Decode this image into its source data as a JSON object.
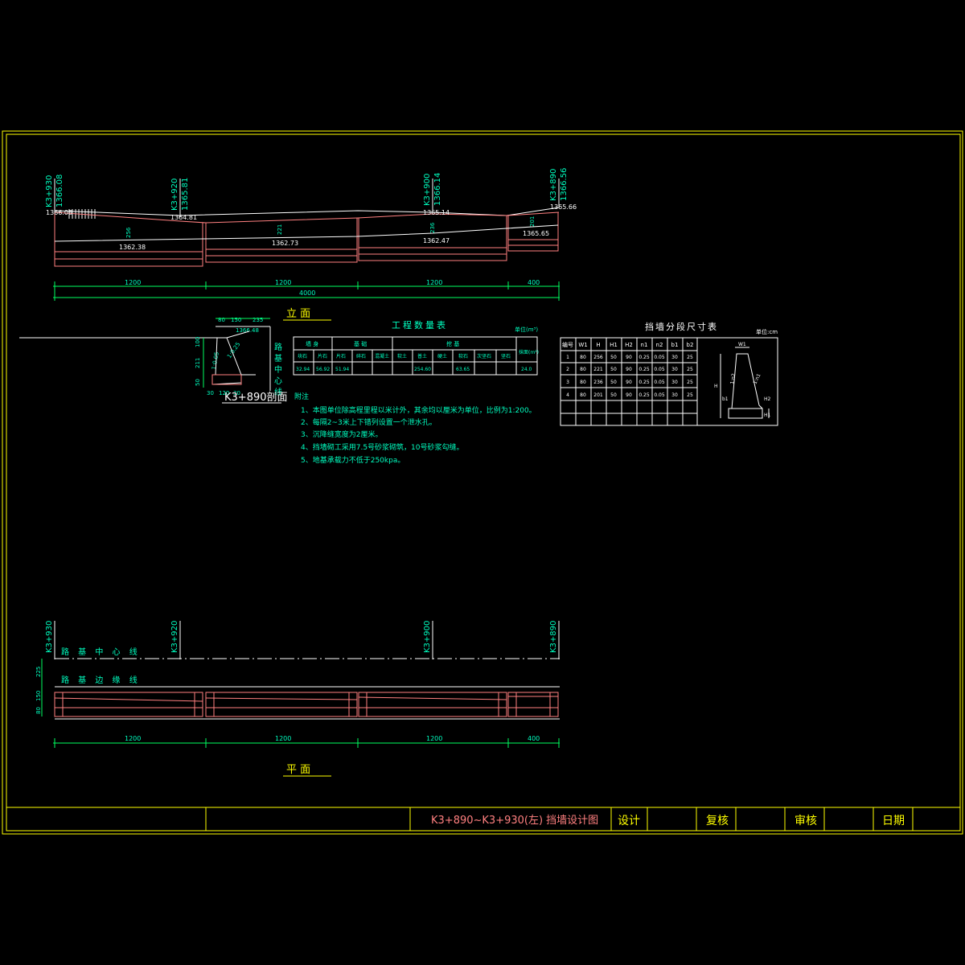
{
  "colors": {
    "background": "#000000",
    "frame": "#ffff00",
    "wall": "#ff8080",
    "text": "#00ffc0",
    "line": "#ffffff",
    "dim": "#00ff60"
  },
  "elevation_view": {
    "title": "立  面",
    "stations": [
      {
        "label": "K3+930",
        "elev": "1366.08"
      },
      {
        "label": "K3+920",
        "elev": "1365.81"
      },
      {
        "label": "K3+900",
        "elev": "1366.14"
      },
      {
        "label": "K3+890",
        "elev": "1366.56"
      }
    ],
    "spot_elevs": [
      "1366.08",
      "1364.81",
      "1362.38",
      "1362.73",
      "1365.14",
      "1362.47",
      "1365.66",
      "1365.65"
    ],
    "seg_heights": [
      "256",
      "221",
      "236",
      "201"
    ],
    "dims": [
      "1200",
      "1200",
      "1200",
      "400"
    ],
    "total_dim": "4000"
  },
  "section_view": {
    "title": "K3+890剖面",
    "top_dims": [
      "80",
      "150",
      "235"
    ],
    "elev": "1366.48",
    "side_dims": [
      "100",
      "211",
      "50"
    ],
    "slope_1": "1:0.05",
    "slope_2": "1:0.25",
    "bottom_dims": [
      "30",
      "120",
      "30"
    ],
    "center_label": "路基中心线"
  },
  "quantity_table": {
    "title": "工程数量表",
    "unit": "单位(m³)",
    "group_headers": [
      "墙 身",
      "基 础",
      "挖 基"
    ],
    "columns": [
      "块石",
      "片石",
      "片石",
      "碎石",
      "混凝土",
      "软土",
      "普土",
      "硬土",
      "软石",
      "次坚石",
      "坚石"
    ],
    "last_header": "抹面(m²)",
    "values": [
      "32.94",
      "56.92",
      "51.94",
      "",
      "",
      "",
      "254.60",
      "",
      "63.65",
      "",
      "",
      "24.0"
    ]
  },
  "size_table": {
    "title": "挡墙分段尺寸表",
    "unit": "单位:cm",
    "headers": [
      "编号",
      "W1",
      "H",
      "H1",
      "H2",
      "n1",
      "n2",
      "b1",
      "b2"
    ],
    "rows": [
      [
        "1",
        "80",
        "256",
        "50",
        "90",
        "0.25",
        "0.05",
        "30",
        "25"
      ],
      [
        "2",
        "80",
        "221",
        "50",
        "90",
        "0.25",
        "0.05",
        "30",
        "25"
      ],
      [
        "3",
        "80",
        "236",
        "50",
        "90",
        "0.25",
        "0.05",
        "30",
        "25"
      ],
      [
        "4",
        "80",
        "201",
        "50",
        "90",
        "0.25",
        "0.05",
        "30",
        "25"
      ]
    ],
    "sketch_labels": [
      "W1",
      "H",
      "1:n2",
      "1:n1",
      "b1",
      "H2",
      "H1"
    ]
  },
  "notes": {
    "title": "附注",
    "items": [
      "1、本图单位除高程里程以米计外，其余均以厘米为单位，比例为1:200。",
      "2、每隔2~3米上下错列设置一个泄水孔。",
      "3、沉降缝宽度为2厘米。",
      "4、挡墙砌工采用7.5号砂浆砌筑，10号砂浆勾缝。",
      "5、地基承载力不低于250kpa。"
    ]
  },
  "plan_view": {
    "title": "平  面",
    "stations": [
      "K3+930",
      "K3+920",
      "K3+900",
      "K3+890"
    ],
    "center_line": "路 基 中 心 线",
    "edge_line": "路 基 边 缘 线",
    "left_dims": [
      "225",
      "150",
      "80"
    ],
    "dims": [
      "1200",
      "1200",
      "1200",
      "400"
    ]
  },
  "title_block": {
    "drawing_title": "K3+890~K3+930(左) 挡墙设计图",
    "design": "设计",
    "review": "复核",
    "approve": "审核",
    "date": "日期"
  }
}
